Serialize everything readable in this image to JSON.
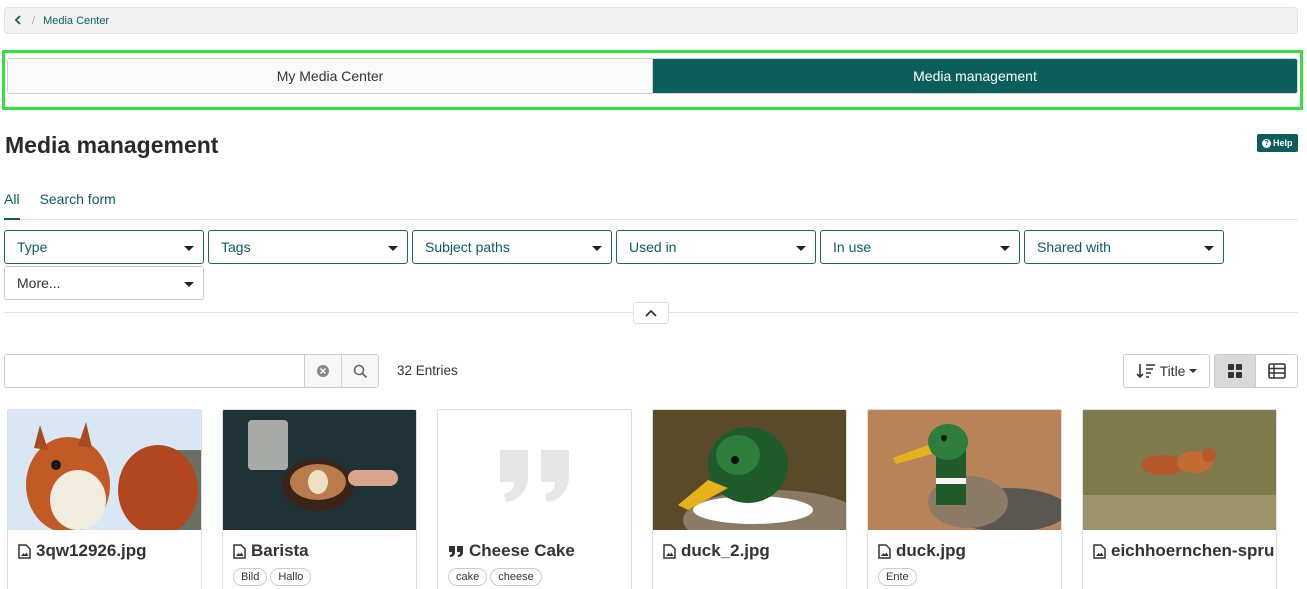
{
  "breadcrumb": {
    "current": "Media Center"
  },
  "segments": {
    "my_media_center": "My Media Center",
    "media_management": "Media management"
  },
  "page": {
    "title": "Media management",
    "help_label": "Help"
  },
  "filter_tabs": [
    "All",
    "Search form"
  ],
  "filters": [
    "Type",
    "Tags",
    "Subject paths",
    "Used in",
    "In use",
    "Shared with",
    "More..."
  ],
  "search": {
    "placeholder": "",
    "value": ""
  },
  "entries_label": "32 Entries",
  "sort_label": "Title",
  "cards": [
    {
      "title": "3qw12926.jpg",
      "icon": "image-file-icon",
      "tags": []
    },
    {
      "title": "Barista",
      "icon": "image-file-icon",
      "tags": [
        "Bild",
        "Hallo"
      ]
    },
    {
      "title": "Cheese Cake",
      "icon": "quote-icon",
      "tags": [
        "cake",
        "cheese"
      ]
    },
    {
      "title": "duck_2.jpg",
      "icon": "image-file-icon",
      "tags": []
    },
    {
      "title": "duck.jpg",
      "icon": "image-file-icon",
      "tags": [
        "Ente"
      ]
    },
    {
      "title": "eichhoernchen-spru",
      "icon": "image-file-icon",
      "tags": []
    }
  ],
  "colors": {
    "accent": "#0b5e5b",
    "highlight_frame": "#33e23a"
  }
}
